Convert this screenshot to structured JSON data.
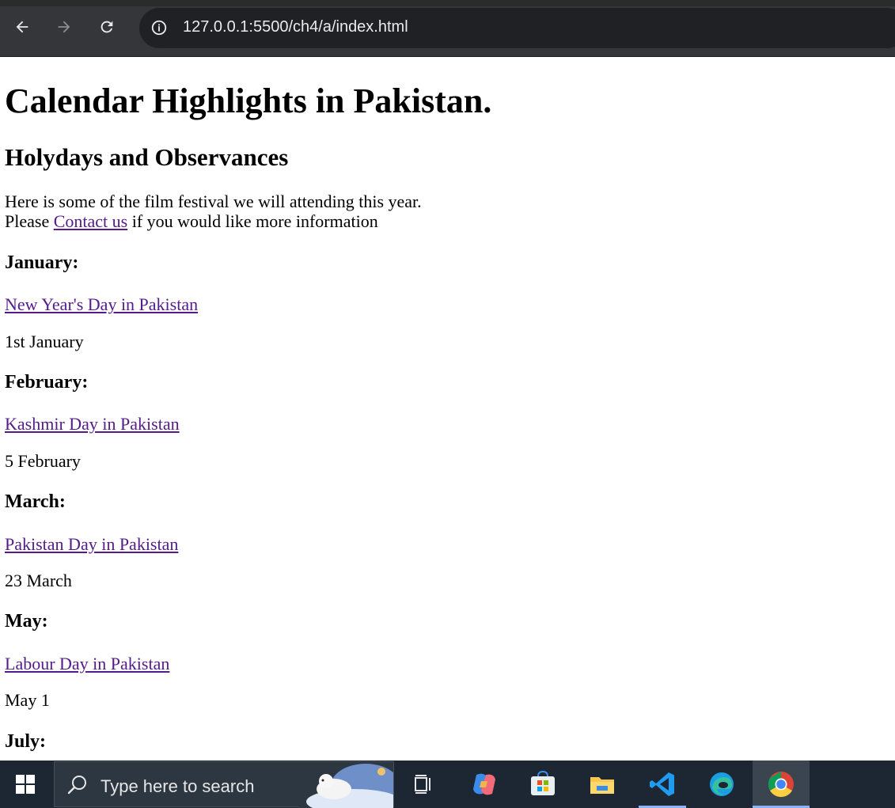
{
  "browser": {
    "url": "127.0.0.1:5500/ch4/a/index.html"
  },
  "page": {
    "title": "Calendar Highlights in Pakistan.",
    "subtitle": "Holydays and Observances",
    "intro_line1": "Here is some of the film festival we will attending this year.",
    "intro_line2_before": "Please ",
    "intro_link": "Contact us",
    "intro_line2_after": " if you would like more information",
    "months": [
      {
        "title": "January:",
        "link": "New Year's Day in Pakistan",
        "date": "1st January"
      },
      {
        "title": "February:",
        "link": "Kashmir Day in Pakistan",
        "date": "5 February"
      },
      {
        "title": "March:",
        "link": "Pakistan Day in Pakistan",
        "date": "23 March"
      },
      {
        "title": "May:",
        "link": "Labour Day in Pakistan",
        "date": "May 1"
      },
      {
        "title": "July:"
      }
    ]
  },
  "taskbar": {
    "search_placeholder": "Type here to search"
  },
  "colors": {
    "link_visited": "#551a8b",
    "chrome_bg": "#35363a",
    "taskbar_bg": "#1c2733"
  }
}
